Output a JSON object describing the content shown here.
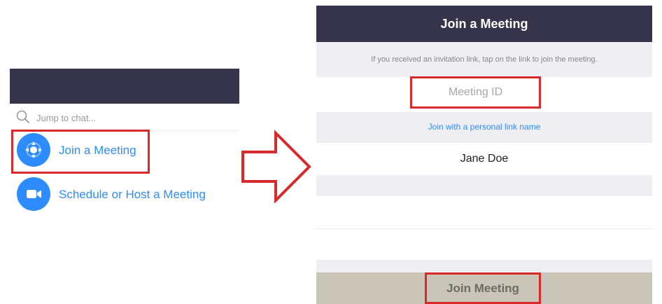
{
  "left_panel": {
    "search": {
      "placeholder": "Jump to chat..."
    },
    "menu": [
      {
        "label": "Join a Meeting",
        "icon": "join-meeting-icon"
      },
      {
        "label": "Schedule or Host a Meeting",
        "icon": "video-camera-icon"
      }
    ]
  },
  "right_panel": {
    "title": "Join a Meeting",
    "info": "If you received an invitation link, tap on the link to join the meeting.",
    "meeting_id_placeholder": "Meeting ID",
    "personal_link": "Join with a personal link name",
    "name_value": "Jane Doe",
    "join_button": "Join Meeting"
  },
  "colors": {
    "header": "#35344a",
    "accent": "#2d8cff",
    "highlight": "#d82a2a",
    "join_bar": "#c9c5b9"
  }
}
